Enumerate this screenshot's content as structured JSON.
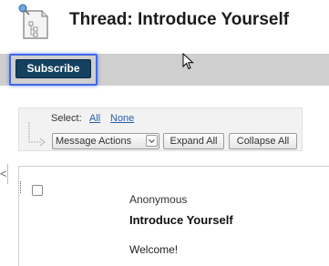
{
  "header": {
    "title": "Thread: Introduce Yourself",
    "icon": "thread-document-icon"
  },
  "action_bar": {
    "subscribe_label": "Subscribe",
    "focus_color": "#3f68e6",
    "button_color": "#14415f"
  },
  "toolbar": {
    "select_label": "Select:",
    "select_all": "All",
    "select_none": "None",
    "message_actions": "Message Actions",
    "expand_all": "Expand All",
    "collapse_all": "Collapse All"
  },
  "message": {
    "author": "Anonymous",
    "title": "Introduce Yourself",
    "body": "Welcome!"
  },
  "side": {
    "collapse_arrow": "<"
  },
  "colors": {
    "link": "#2a5fad",
    "bar": "#cfcfcf"
  }
}
